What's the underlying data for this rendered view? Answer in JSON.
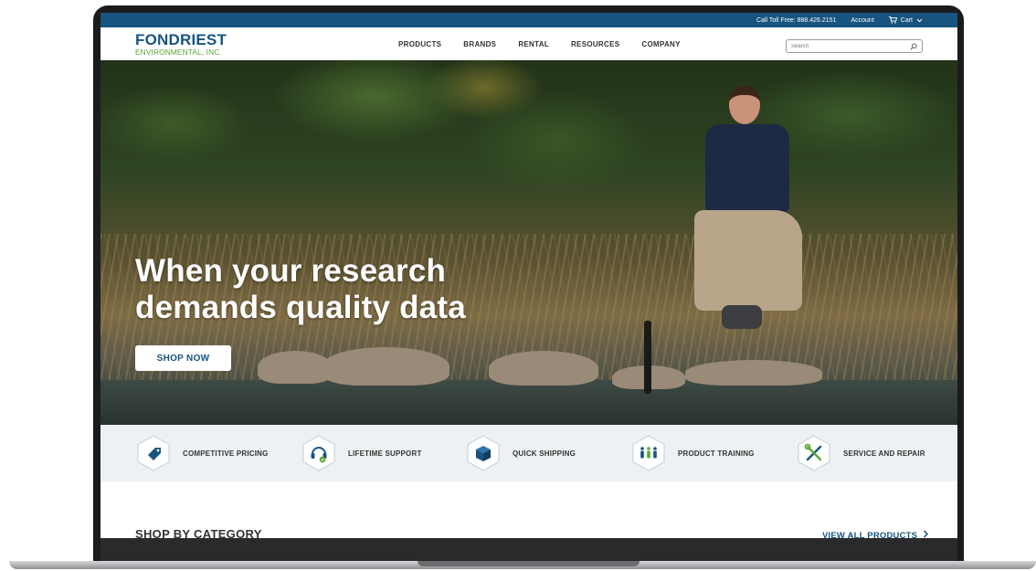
{
  "utility_bar": {
    "phone": "Call Toll Free: 888.426.2151",
    "account": "Account",
    "cart": "Cart",
    "cart_icon": "cart-icon",
    "chevron_icon": "chevron-down-icon"
  },
  "header": {
    "logo_main": "FONDRIEST",
    "logo_sub": "ENVIRONMENTAL, INC.",
    "nav": [
      "PRODUCTS",
      "BRANDS",
      "RENTAL",
      "RESOURCES",
      "COMPANY"
    ],
    "search_placeholder": "Search"
  },
  "hero": {
    "headline_line1": "When your research",
    "headline_line2": "demands quality data",
    "cta": "SHOP NOW"
  },
  "features": [
    {
      "label": "COMPETITIVE PRICING",
      "icon": "price-tag-icon"
    },
    {
      "label": "LIFETIME SUPPORT",
      "icon": "headset-icon"
    },
    {
      "label": "QUICK SHIPPING",
      "icon": "box-icon"
    },
    {
      "label": "PRODUCT TRAINING",
      "icon": "people-icon"
    },
    {
      "label": "SERVICE AND REPAIR",
      "icon": "tools-icon"
    }
  ],
  "category": {
    "title": "SHOP BY CATEGORY",
    "view_all": "VIEW ALL PRODUCTS"
  },
  "colors": {
    "brand_blue": "#17547f",
    "brand_green": "#5aa63a",
    "feature_bg": "#eef1f3"
  }
}
